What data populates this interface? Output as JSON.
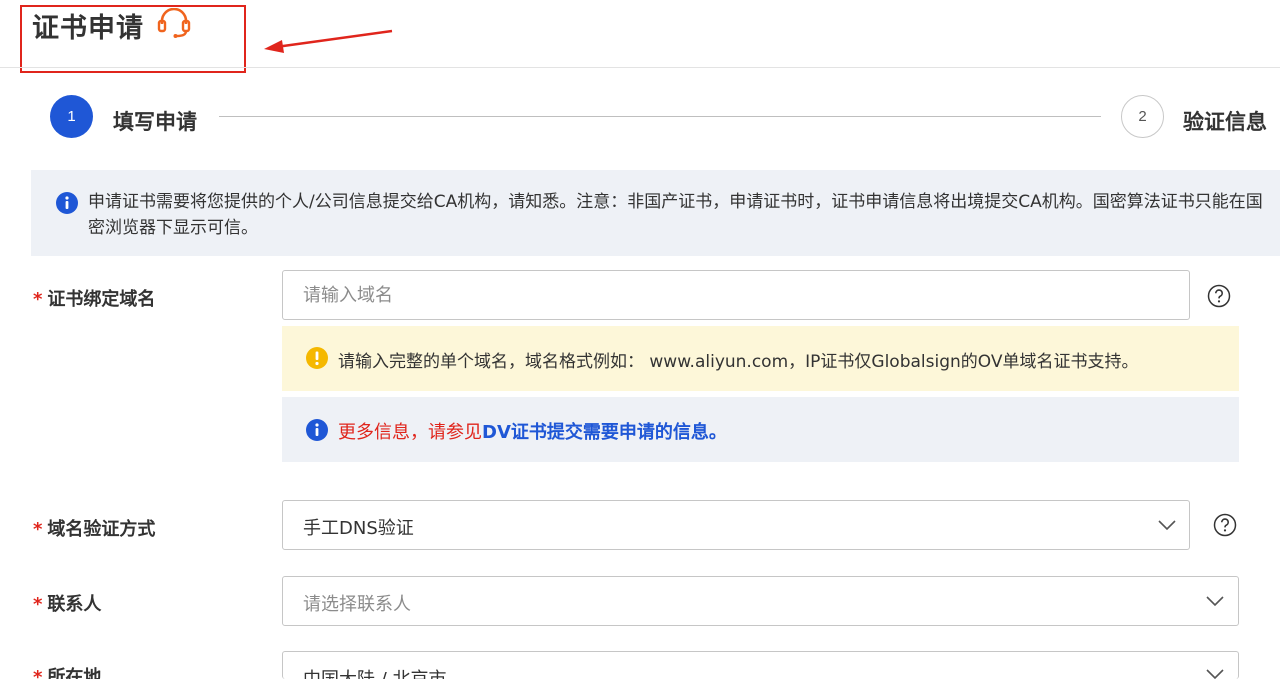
{
  "header": {
    "title": "证书申请",
    "support_icon": "headset-icon",
    "annotation_color": "#e0251c"
  },
  "steps": [
    {
      "number": "1",
      "label": "填写申请",
      "active": true
    },
    {
      "number": "2",
      "label": "验证信息",
      "active": false
    }
  ],
  "notice": {
    "icon": "info-icon",
    "text": "申请证书需要将您提供的个人/公司信息提交给CA机构，请知悉。注意：非国产证书，申请证书时，证书申请信息将出境提交CA机构。国密算法证书只能在国密浏览器下显示可信。"
  },
  "form": {
    "domain": {
      "required_mark": "*",
      "label": "证书绑定域名",
      "placeholder": "请输入域名",
      "help_icon": "question-circle-icon",
      "warning": "请输入完整的单个域名，域名格式例如： www.aliyun.com，IP证书仅Globalsign的OV单域名证书支持。",
      "more_prefix": "更多信息，请参见",
      "more_link": "DV证书提交需要申请的信息。"
    },
    "verify_method": {
      "required_mark": "*",
      "label": "域名验证方式",
      "value": "手工DNS验证",
      "help_icon": "question-circle-icon"
    },
    "contact": {
      "required_mark": "*",
      "label": "联系人",
      "placeholder": "请选择联系人"
    },
    "location": {
      "required_mark": "*",
      "label": "所在地",
      "value": "中国大陆 / 北京市"
    }
  },
  "colors": {
    "primary": "#1f57d6",
    "danger": "#e0251c",
    "warning": "#f5b800",
    "orange_icon": "#f0641e"
  }
}
